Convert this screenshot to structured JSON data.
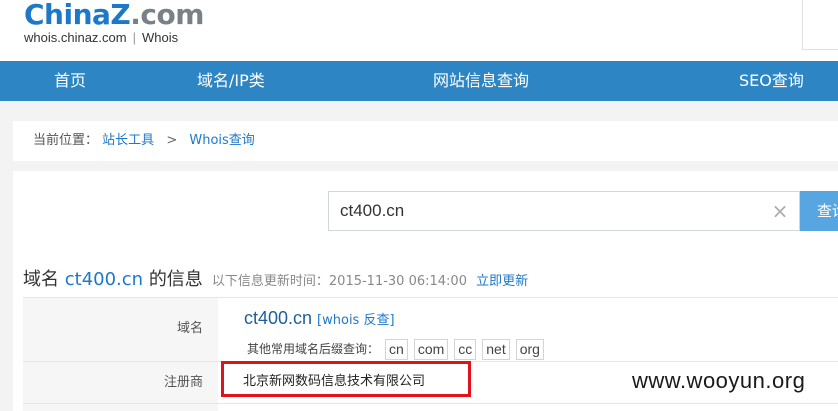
{
  "header": {
    "logo_china": "China",
    "logo_z": "Z",
    "logo_dot": ".",
    "logo_com": "com",
    "sub_left": "whois.chinaz.com",
    "sub_sep": "|",
    "sub_right": "Whois"
  },
  "nav": {
    "items": [
      "首页",
      "域名/IP类",
      "网站信息查询",
      "SEO查询"
    ]
  },
  "breadcrumb": {
    "prefix": "当前位置：",
    "item1": "站长工具",
    "sep": ">",
    "item2": "Whois查询"
  },
  "search": {
    "value": "ct400.cn",
    "clear_glyph": "×",
    "button_label": "查询"
  },
  "info": {
    "title_prefix": "域名",
    "domain": "ct400.cn",
    "title_suffix": "的信息",
    "update_note": "以下信息更新时间：2015-11-30 06:14:00",
    "update_link": "立即更新"
  },
  "table": {
    "domain_label": "域名",
    "domain_value": "ct400.cn",
    "whois_reverse": "[whois 反查]",
    "suffix_prompt": "其他常用域名后缀查询：",
    "suffixes": [
      "cn",
      "com",
      "cc",
      "net",
      "org"
    ],
    "registrar_label": "注册商",
    "registrar_value": "北京新网数码信息技术有限公司"
  },
  "watermark": "www.wooyun.org",
  "colors": {
    "nav_bg": "#2d86c3",
    "link": "#1e78c8",
    "highlight_box": "#e0131c"
  }
}
